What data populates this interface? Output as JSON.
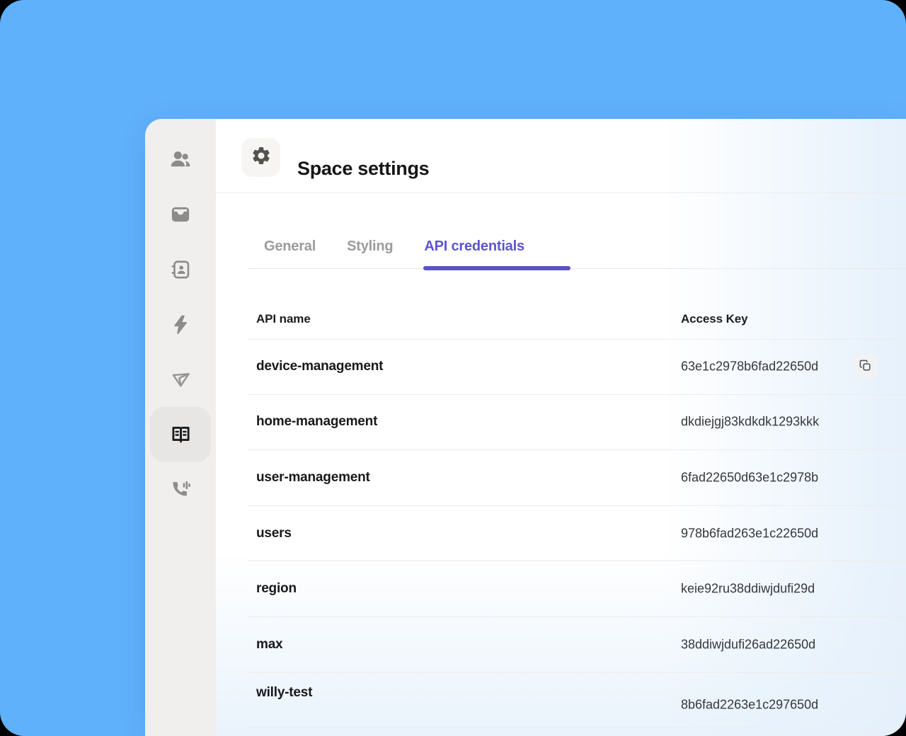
{
  "colors": {
    "background_blue": "#60b1fc",
    "accent_purple": "#5b55cf",
    "tab_underline": "#5a52ca",
    "sidebar_bg": "#f0efee",
    "sidebar_active_bg": "#e7e6e4",
    "divider": "#ececec",
    "card_tint": "#e4f0fb"
  },
  "header": {
    "title": "Space settings",
    "icon": "gear-icon"
  },
  "tabs": {
    "items": [
      {
        "label": "General",
        "active": false
      },
      {
        "label": "Styling",
        "active": false
      },
      {
        "label": "API credentials",
        "active": true
      }
    ]
  },
  "sidebar": {
    "items": [
      {
        "icon": "users-icon",
        "active": false
      },
      {
        "icon": "inbox-tray-icon",
        "active": false
      },
      {
        "icon": "address-book-icon",
        "active": false
      },
      {
        "icon": "lightning-icon",
        "active": false
      },
      {
        "icon": "paper-plane-icon",
        "active": false
      },
      {
        "icon": "book-open-icon",
        "active": true
      },
      {
        "icon": "phone-waves-icon",
        "active": false
      }
    ]
  },
  "table": {
    "columns": [
      "API name",
      "Access Key"
    ],
    "rows": [
      {
        "name": "device-management",
        "key": "63e1c2978b6fad22650d",
        "copyable": true
      },
      {
        "name": "home-management",
        "key": "dkdiejgj83kdkdk1293kkk",
        "copyable": false
      },
      {
        "name": "user-management",
        "key": "6fad22650d63e1c2978b",
        "copyable": false
      },
      {
        "name": "users",
        "key": "978b6fad263e1c22650d",
        "copyable": false
      },
      {
        "name": "region",
        "key": "keie92ru38ddiwjdufi29d",
        "copyable": false
      },
      {
        "name": "max",
        "key": "38ddiwjdufi26ad22650d",
        "copyable": false
      },
      {
        "name": "willy-test",
        "key": "8b6fad2263e1c297650d",
        "copyable": false
      }
    ]
  }
}
